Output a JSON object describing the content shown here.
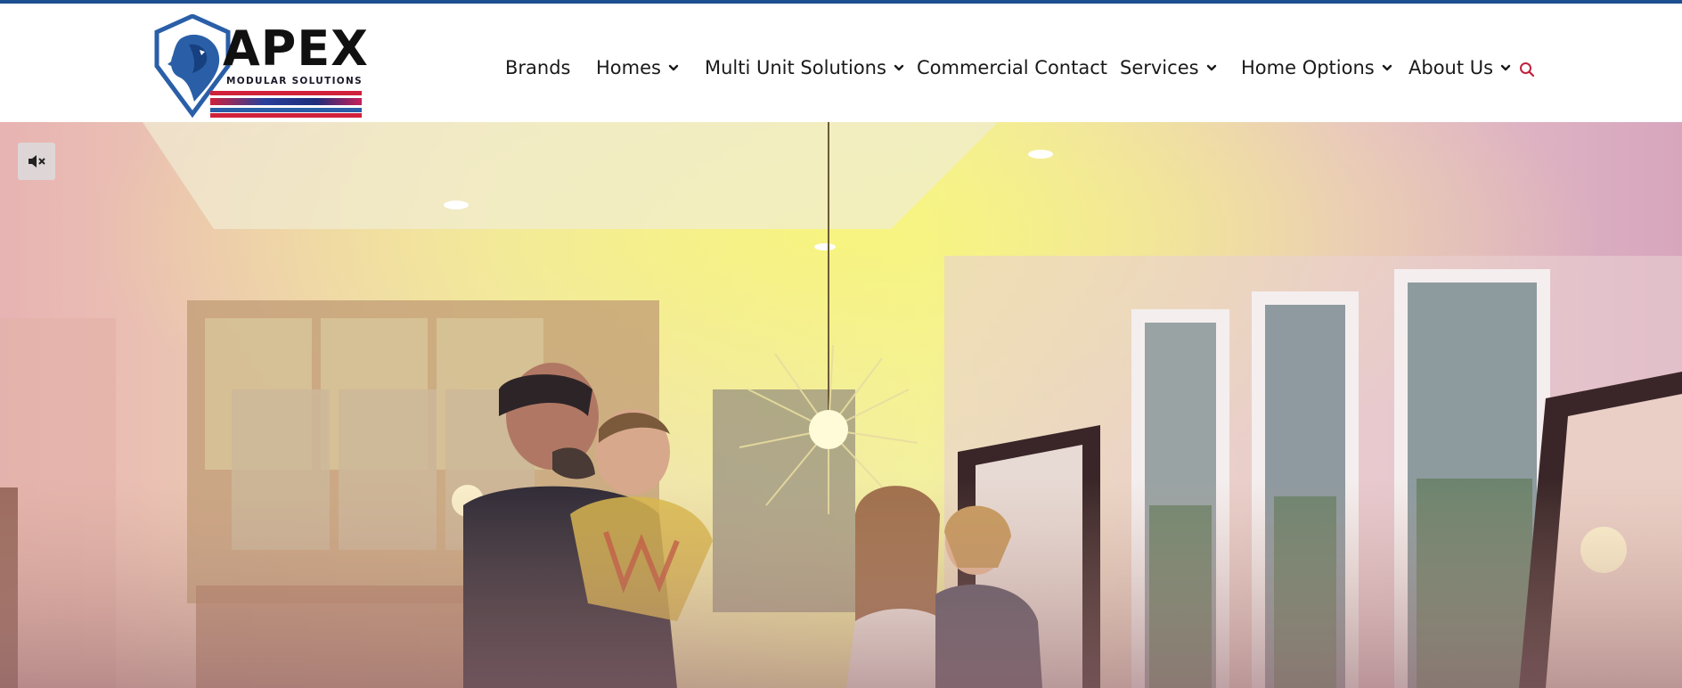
{
  "brand": {
    "logo_word": "APEX",
    "logo_sub": "MODULAR SOLUTIONS"
  },
  "nav": {
    "items": [
      {
        "label": "Brands",
        "has_dropdown": false
      },
      {
        "label": "Homes",
        "has_dropdown": true
      },
      {
        "label": "Multi Unit Solutions",
        "has_dropdown": true
      },
      {
        "label": "Commercial Contact",
        "has_dropdown": false
      },
      {
        "label": "Services",
        "has_dropdown": true
      },
      {
        "label": "Home Options",
        "has_dropdown": true
      },
      {
        "label": "About Us",
        "has_dropdown": true
      }
    ],
    "search_icon": "search-icon"
  },
  "hero": {
    "media": "video",
    "mute_icon": "speaker-muted-icon"
  },
  "colors": {
    "accent": "#1c4f8f",
    "search_icon": "#c0223d",
    "logo_blue": "#2a5fa8",
    "logo_red": "#d0213b"
  }
}
